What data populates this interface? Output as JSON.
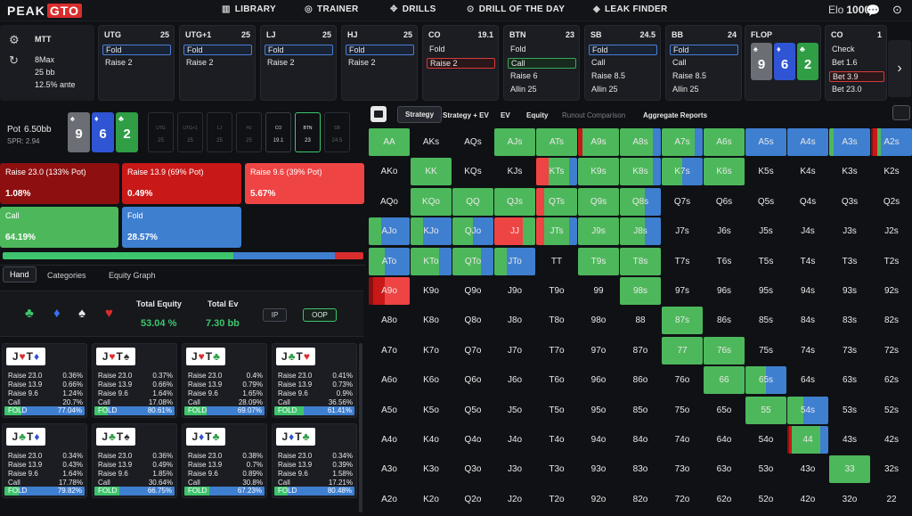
{
  "logo": {
    "part1": "PEAK",
    "part2": "GTO"
  },
  "nav": [
    {
      "label": "LIBRARY",
      "icon": "library-icon",
      "glyph": "▥"
    },
    {
      "label": "TRAINER",
      "icon": "controller-icon",
      "glyph": "◎"
    },
    {
      "label": "DRILLS",
      "icon": "crosshair-icon",
      "glyph": "✥"
    },
    {
      "label": "DRILL OF THE DAY",
      "icon": "target-icon",
      "glyph": "⊙"
    },
    {
      "label": "LEAK FINDER",
      "icon": "flame-icon",
      "glyph": "◆"
    }
  ],
  "elo": {
    "label": "Elo",
    "value": "1000"
  },
  "settings": {
    "format": "MTT",
    "table": "8Max",
    "stack": "25 bb",
    "ante": "12.5% ante"
  },
  "positions": [
    {
      "name": "UTG",
      "stack": "25",
      "actions": [
        {
          "label": "Fold",
          "style": "sel-blue"
        },
        {
          "label": "Raise 2",
          "style": ""
        }
      ]
    },
    {
      "name": "UTG+1",
      "stack": "25",
      "actions": [
        {
          "label": "Fold",
          "style": "sel-blue"
        },
        {
          "label": "Raise 2",
          "style": ""
        }
      ]
    },
    {
      "name": "LJ",
      "stack": "25",
      "actions": [
        {
          "label": "Fold",
          "style": "sel-blue"
        },
        {
          "label": "Raise 2",
          "style": ""
        }
      ]
    },
    {
      "name": "HJ",
      "stack": "25",
      "actions": [
        {
          "label": "Fold",
          "style": "sel-blue"
        },
        {
          "label": "Raise 2",
          "style": ""
        }
      ]
    },
    {
      "name": "CO",
      "stack": "19.1",
      "actions": [
        {
          "label": "Fold",
          "style": ""
        },
        {
          "label": "Raise 2",
          "style": "sel-red"
        }
      ]
    },
    {
      "name": "BTN",
      "stack": "23",
      "actions": [
        {
          "label": "Fold",
          "style": ""
        },
        {
          "label": "Call",
          "style": "sel-green"
        },
        {
          "label": "Raise 6",
          "style": ""
        },
        {
          "label": "Allin 25",
          "style": ""
        }
      ]
    },
    {
      "name": "SB",
      "stack": "24.5",
      "actions": [
        {
          "label": "Fold",
          "style": "sel-blue"
        },
        {
          "label": "Call",
          "style": ""
        },
        {
          "label": "Raise 8.5",
          "style": ""
        },
        {
          "label": "Allin 25",
          "style": ""
        }
      ]
    },
    {
      "name": "BB",
      "stack": "24",
      "actions": [
        {
          "label": "Fold",
          "style": "sel-blue"
        },
        {
          "label": "Call",
          "style": ""
        },
        {
          "label": "Raise 8.5",
          "style": ""
        },
        {
          "label": "Allin 25",
          "style": ""
        }
      ]
    }
  ],
  "flop": {
    "name": "FLOP",
    "cards": [
      {
        "rank": "9",
        "suit": "♠",
        "color": "#6b6e74"
      },
      {
        "rank": "6",
        "suit": "♦",
        "color": "#2f55d4"
      },
      {
        "rank": "2",
        "suit": "♣",
        "color": "#2f9e45"
      }
    ]
  },
  "co_card": {
    "name": "CO",
    "stack": "1",
    "actions": [
      {
        "label": "Check",
        "style": ""
      },
      {
        "label": "Bet 1.6",
        "style": ""
      },
      {
        "label": "Bet 3.9",
        "style": "sel-red"
      },
      {
        "label": "Bet 23.0",
        "style": ""
      }
    ]
  },
  "pot": {
    "label": "Pot",
    "value": "6.50bb",
    "spr": "SPR: 2.94"
  },
  "mini_seats": [
    {
      "name": "UTG",
      "stack": "25",
      "state": ""
    },
    {
      "name": "UTG+1",
      "stack": "25",
      "state": ""
    },
    {
      "name": "LJ",
      "stack": "25",
      "state": ""
    },
    {
      "name": "HJ",
      "stack": "25",
      "state": ""
    },
    {
      "name": "CO",
      "stack": "19.1",
      "state": "done"
    },
    {
      "name": "BTN",
      "stack": "23",
      "state": "cur"
    },
    {
      "name": "SB",
      "stack": "24.5",
      "state": ""
    }
  ],
  "actions": [
    {
      "label": "Raise 23.0 (133% Pot)",
      "pct": "1.08%",
      "color": "#8e0f10"
    },
    {
      "label": "Raise 13.9 (69% Pot)",
      "pct": "0.49%",
      "color": "#c81818"
    },
    {
      "label": "Raise 9.6 (39% Pot)",
      "pct": "5.67%",
      "color": "#ef4444"
    },
    {
      "label": "Call",
      "pct": "64.19%",
      "color": "#4db85b"
    },
    {
      "label": "Fold",
      "pct": "28.57%",
      "color": "#3f7fd0"
    }
  ],
  "freq_bar": [
    0.3,
    0.64,
    0.28,
    0.07
  ],
  "tabs": [
    "Hand",
    "Categories",
    "Equity Graph"
  ],
  "equity": {
    "eq_label": "Total Equity",
    "eq_value": "53.04 %",
    "ev_label": "Total Ev",
    "ev_value": "7.30 bb",
    "ip": "IP",
    "oop": "OOP"
  },
  "suits": [
    {
      "glyph": "♣",
      "color": "#3ec46d",
      "icon": "club-icon"
    },
    {
      "glyph": "♦",
      "color": "#3a6ff2",
      "icon": "diamond-icon"
    },
    {
      "glyph": "♠",
      "color": "#e8e8e8",
      "icon": "spade-icon"
    },
    {
      "glyph": "♥",
      "color": "#d92d2d",
      "icon": "heart-icon"
    }
  ],
  "hand_cards": [
    {
      "c1": "J",
      "s1": "♥",
      "sc1": "#d92d2d",
      "c2": "T",
      "s2": "♦",
      "sc2": "#2f55d4",
      "r1": "0.36%",
      "r2": "0.66%",
      "r3": "1.24%",
      "call": "20.7%",
      "fold": "77.04%",
      "cf": 0.21
    },
    {
      "c1": "J",
      "s1": "♥",
      "sc1": "#d92d2d",
      "c2": "T",
      "s2": "♠",
      "sc2": "#333",
      "r1": "0.37%",
      "r2": "0.66%",
      "r3": "1.64%",
      "call": "17.08%",
      "fold": "80.61%",
      "cf": 0.17
    },
    {
      "c1": "J",
      "s1": "♥",
      "sc1": "#d92d2d",
      "c2": "T",
      "s2": "♣",
      "sc2": "#2f9e45",
      "r1": "0.4%",
      "r2": "0.79%",
      "r3": "1.65%",
      "call": "28.09%",
      "fold": "69.07%",
      "cf": 0.28
    },
    {
      "c1": "J",
      "s1": "♣",
      "sc1": "#2f9e45",
      "c2": "T",
      "s2": "♥",
      "sc2": "#d92d2d",
      "r1": "0.41%",
      "r2": "0.73%",
      "r3": "0.9%",
      "call": "36.56%",
      "fold": "61.41%",
      "cf": 0.37
    },
    {
      "c1": "J",
      "s1": "♣",
      "sc1": "#2f9e45",
      "c2": "T",
      "s2": "♦",
      "sc2": "#2f55d4",
      "r1": "0.34%",
      "r2": "0.43%",
      "r3": "1.64%",
      "call": "17.78%",
      "fold": "79.82%",
      "cf": 0.18
    },
    {
      "c1": "J",
      "s1": "♣",
      "sc1": "#2f9e45",
      "c2": "T",
      "s2": "♠",
      "sc2": "#333",
      "r1": "0.36%",
      "r2": "0.49%",
      "r3": "1.85%",
      "call": "30.64%",
      "fold": "66.75%",
      "cf": 0.31
    },
    {
      "c1": "J",
      "s1": "♦",
      "sc1": "#2f55d4",
      "c2": "T",
      "s2": "♣",
      "sc2": "#2f9e45",
      "r1": "0.38%",
      "r2": "0.7%",
      "r3": "0.89%",
      "call": "30.8%",
      "fold": "67.23%",
      "cf": 0.31
    },
    {
      "c1": "J",
      "s1": "♦",
      "sc1": "#2f55d4",
      "c2": "T",
      "s2": "♣",
      "sc2": "#2f9e45",
      "r1": "0.34%",
      "r2": "0.39%",
      "r3": "1.58%",
      "call": "17.21%",
      "fold": "80.48%",
      "cf": 0.17
    }
  ],
  "hand_labels": {
    "r1": "Raise 23.0",
    "r2": "Raise 13.9",
    "r3": "Raise 9.6",
    "call": "Call",
    "fold": "FOLD"
  },
  "toolbar": [
    {
      "label": "Strategy",
      "state": "act"
    },
    {
      "label": "Strategy + EV",
      "state": ""
    },
    {
      "label": "EV",
      "state": ""
    },
    {
      "label": "Equity",
      "state": ""
    },
    {
      "label": "Runout Comparison",
      "state": "dim"
    },
    {
      "label": "Aggregate Reports",
      "state": ""
    }
  ],
  "ranks": [
    "A",
    "K",
    "Q",
    "J",
    "T",
    "9",
    "8",
    "7",
    "6",
    "5",
    "4",
    "3",
    "2"
  ],
  "grid_fills": {
    "AA": [
      0.0,
      0.0,
      0.0,
      1.0,
      0.0
    ],
    "AJs": [
      0,
      0,
      0,
      1,
      0
    ],
    "ATs": [
      0,
      0,
      0,
      1,
      0
    ],
    "A9s": [
      0,
      0.1,
      0,
      0.9,
      0
    ],
    "A8s": [
      0,
      0,
      0,
      0.8,
      0.2
    ],
    "A7s": [
      0,
      0,
      0,
      0.8,
      0.2
    ],
    "A6s": [
      0,
      0,
      0,
      1,
      0
    ],
    "A5s": [
      0,
      0,
      0,
      0,
      1
    ],
    "A4s": [
      0,
      0,
      0,
      0,
      1
    ],
    "A3s": [
      0,
      0,
      0,
      0.1,
      0.9
    ],
    "A2s": [
      0.05,
      0.1,
      0,
      0.1,
      0.75
    ],
    "KK": [
      0,
      0,
      0,
      1,
      0
    ],
    "KTs": [
      0,
      0,
      0.3,
      0.5,
      0.2
    ],
    "K9s": [
      0,
      0,
      0,
      1,
      0
    ],
    "K8s": [
      0,
      0,
      0,
      0.8,
      0.2
    ],
    "K7s": [
      0,
      0,
      0,
      0.5,
      0.5
    ],
    "K6s": [
      0,
      0,
      0,
      1,
      0
    ],
    "KQo": [
      0,
      0,
      0,
      1,
      0
    ],
    "QQ": [
      0,
      0,
      0,
      1,
      0
    ],
    "QJs": [
      0,
      0,
      0,
      1,
      0
    ],
    "QTs": [
      0,
      0,
      0.2,
      0.8,
      0
    ],
    "Q9s": [
      0,
      0,
      0,
      1,
      0
    ],
    "Q8s": [
      0,
      0,
      0,
      0.6,
      0.4
    ],
    "AJo": [
      0,
      0,
      0,
      0.3,
      0.7
    ],
    "KJo": [
      0,
      0,
      0,
      0.3,
      0.7
    ],
    "QJo": [
      0,
      0,
      0,
      0.5,
      0.5
    ],
    "JJ": [
      0,
      0,
      0.7,
      0.3,
      0
    ],
    "JTs": [
      0,
      0,
      0.2,
      0.6,
      0.2
    ],
    "J9s": [
      0,
      0,
      0,
      1,
      0
    ],
    "J8s": [
      0,
      0,
      0,
      0.6,
      0.4
    ],
    "ATo": [
      0,
      0,
      0,
      0.4,
      0.6
    ],
    "KTo": [
      0,
      0,
      0,
      0.7,
      0.3
    ],
    "QTo": [
      0,
      0,
      0,
      0.7,
      0.3
    ],
    "JTo": [
      0,
      0,
      0,
      0.3,
      0.7
    ],
    "T9s": [
      0,
      0,
      0,
      1,
      0
    ],
    "T8s": [
      0,
      0,
      0,
      1,
      0
    ],
    "A9o": [
      0.1,
      0.3,
      0.6,
      0,
      0
    ],
    "98s": [
      0,
      0,
      0,
      1,
      0
    ],
    "87s": [
      0,
      0,
      0,
      1,
      0
    ],
    "77": [
      0,
      0,
      0,
      1,
      0
    ],
    "76s": [
      0,
      0,
      0,
      1,
      0
    ],
    "66": [
      0,
      0,
      0,
      1,
      0
    ],
    "65s": [
      0,
      0,
      0,
      0.5,
      0.5
    ],
    "55": [
      0,
      0,
      0,
      1,
      0
    ],
    "54s": [
      0,
      0,
      0,
      0.4,
      0.6
    ],
    "44": [
      0.05,
      0.05,
      0,
      0.7,
      0.2
    ],
    "33": [
      0,
      0,
      0,
      1,
      0
    ]
  }
}
